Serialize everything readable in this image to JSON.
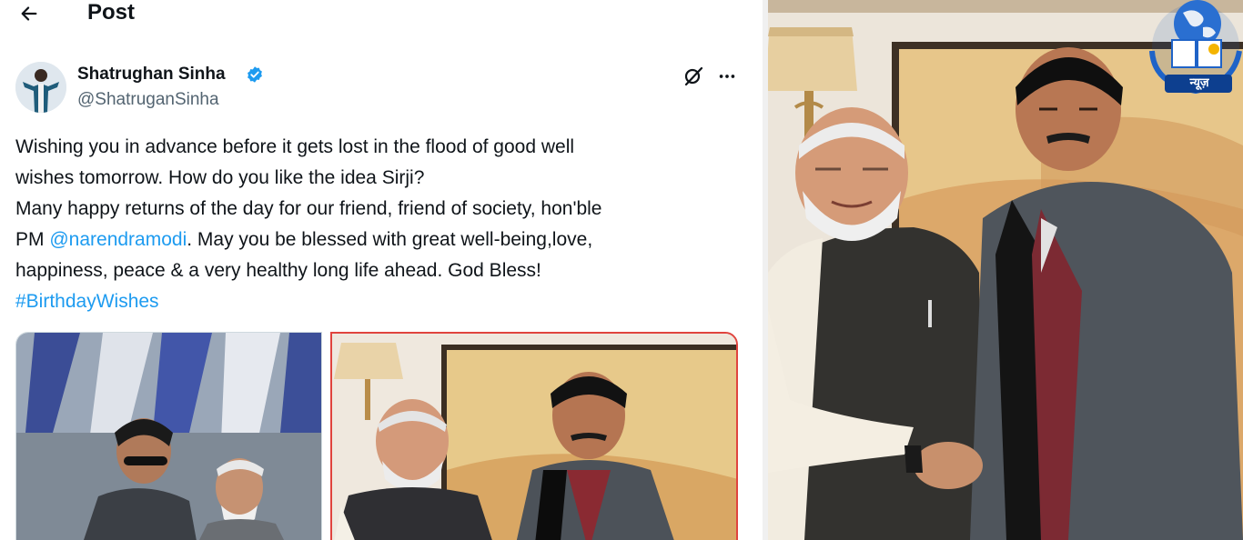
{
  "header": {
    "title": "Post"
  },
  "author": {
    "name": "Shatrughan Sinha",
    "handle": "@ShatruganSinha"
  },
  "post": {
    "lines": [
      "Wishing you in advance before it gets lost in the flood of good well",
      "wishes tomorrow. How do you like the idea Sirji?",
      "Many happy returns of the day for our friend, friend of society, hon'ble"
    ],
    "line4_prefix": "PM ",
    "mention": "@narendramodi",
    "line4_suffix": ". May you be blessed with great well-being,love,",
    "line5": "happiness, peace & a very healthy long life ahead. God Bless!",
    "hashtag": "#BirthdayWishes"
  },
  "logo": {
    "text": "न्यूज़"
  },
  "colors": {
    "link": "#1d9bf0",
    "verified": "#1d9bf0",
    "text": "#0f1419",
    "secondary": "#536471"
  },
  "icons": {
    "back": "arrow-left-icon",
    "verified": "verified-badge-icon",
    "grok": "grok-icon",
    "more": "more-icon"
  }
}
